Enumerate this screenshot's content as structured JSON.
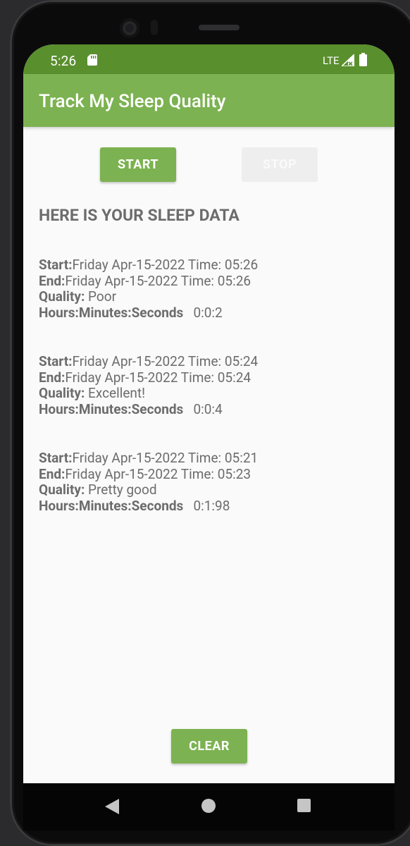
{
  "status_bar": {
    "time": "5:26",
    "network": "LTE",
    "icons": [
      "sd-card-icon",
      "signal-icon",
      "battery-icon"
    ]
  },
  "app_bar": {
    "title": "Track My Sleep Quality"
  },
  "buttons": {
    "start": "START",
    "stop": "STOP",
    "clear": "CLEAR"
  },
  "heading": "HERE IS YOUR SLEEP DATA",
  "labels": {
    "start": "Start:",
    "end": "End:",
    "quality": "Quality:",
    "duration": "Hours:Minutes:Seconds"
  },
  "records": [
    {
      "start": "Friday Apr-15-2022 Time: 05:26",
      "end": "Friday Apr-15-2022 Time: 05:26",
      "quality": "Poor",
      "duration": "0:0:2"
    },
    {
      "start": "Friday Apr-15-2022 Time: 05:24",
      "end": "Friday Apr-15-2022 Time: 05:24",
      "quality": "Excellent!",
      "duration": "0:0:4"
    },
    {
      "start": "Friday Apr-15-2022 Time: 05:21",
      "end": "Friday Apr-15-2022 Time: 05:23",
      "quality": "Pretty good",
      "duration": "0:1:98"
    }
  ],
  "nav_bar": {
    "icons": [
      "back-icon",
      "home-icon",
      "recents-icon"
    ]
  },
  "colors": {
    "status_bar": "#5a8f2d",
    "app_bar": "#7cb251",
    "button": "#7cb251",
    "disabled_button": "#eeeeee",
    "text": "#6c6c6c",
    "background": "#fafafa"
  }
}
